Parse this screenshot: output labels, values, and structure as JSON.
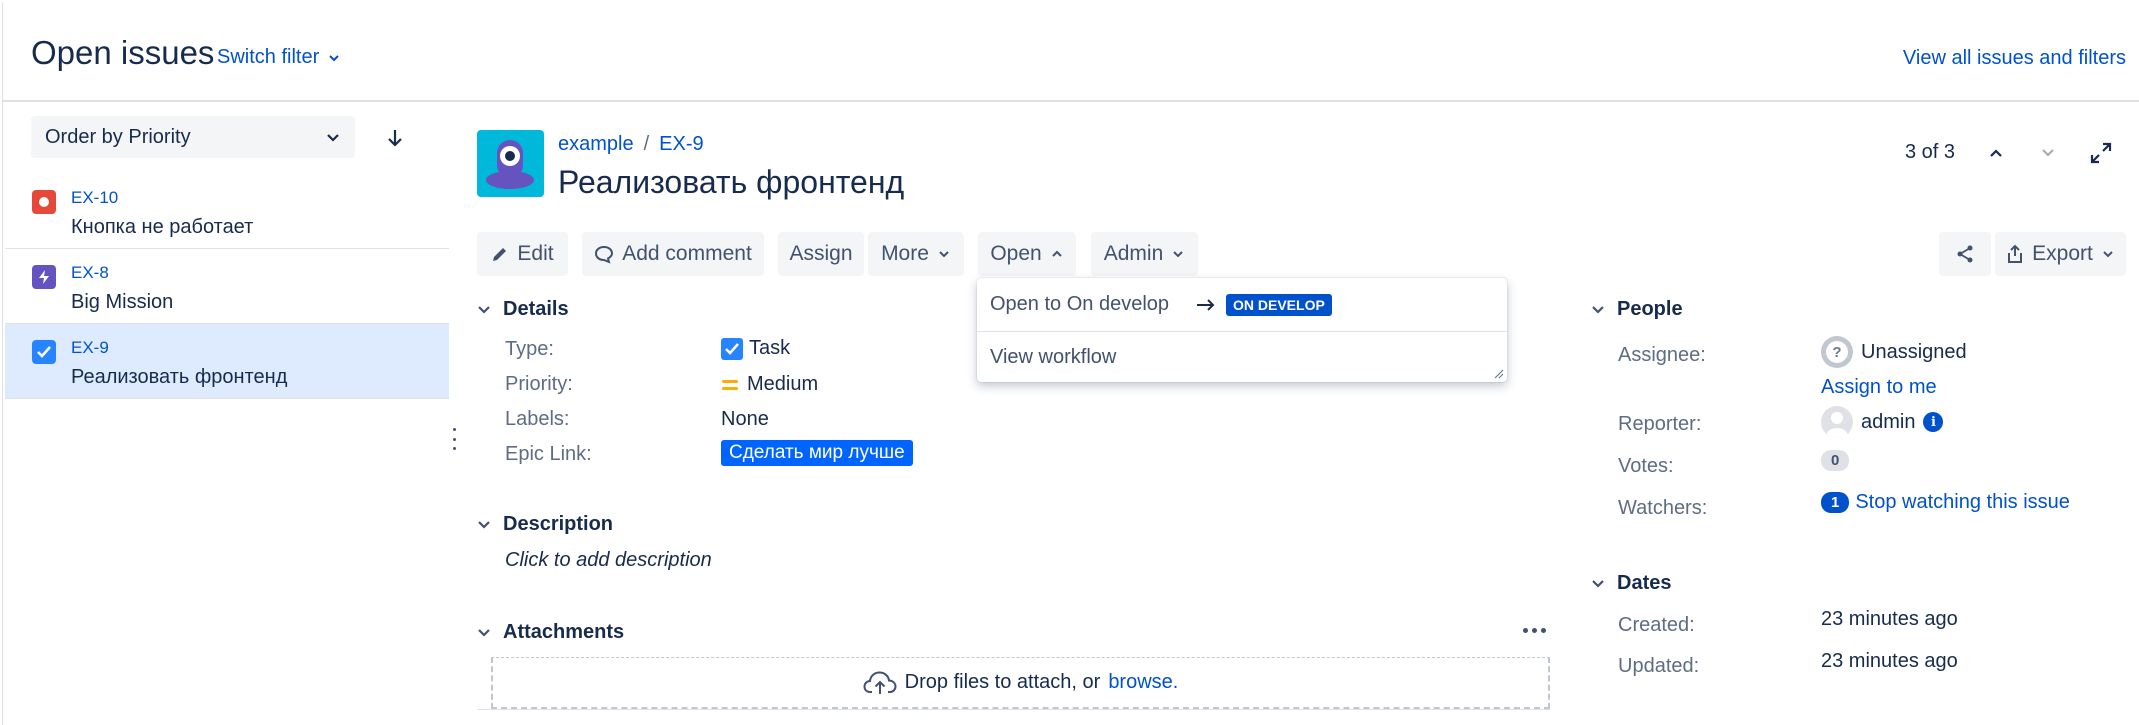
{
  "header": {
    "title": "Open issues",
    "switch_filter": "Switch filter",
    "view_all": "View all issues and filters"
  },
  "sidebar": {
    "order_label": "Order by Priority",
    "items": [
      {
        "key": "EX-10",
        "summary": "Кнопка не работает",
        "type": "bug",
        "color": "#e5493a"
      },
      {
        "key": "EX-8",
        "summary": "Big Mission",
        "type": "epic",
        "color": "#6554c0"
      },
      {
        "key": "EX-9",
        "summary": "Реализовать фронтенд",
        "type": "task",
        "color": "#2684ff"
      }
    ]
  },
  "issue": {
    "project": "example",
    "key": "EX-9",
    "summary": "Реализовать фронтенд",
    "pager": "3 of 3"
  },
  "toolbar": {
    "edit": "Edit",
    "add_comment": "Add comment",
    "assign": "Assign",
    "more": "More",
    "open": "Open",
    "admin": "Admin",
    "export": "Export"
  },
  "dropdown": {
    "transition": "Open to On develop",
    "status_lozenge": "ON DEVELOP",
    "view_workflow": "View workflow"
  },
  "details": {
    "heading": "Details",
    "type_label": "Type:",
    "type_value": "Task",
    "priority_label": "Priority:",
    "priority_value": "Medium",
    "labels_label": "Labels:",
    "labels_value": "None",
    "epic_label": "Epic Link:",
    "epic_value": "Сделать мир лучше"
  },
  "description": {
    "heading": "Description",
    "placeholder": "Click to add description"
  },
  "attachments": {
    "heading": "Attachments",
    "drop_text": "Drop files to attach, or",
    "browse": "browse."
  },
  "people": {
    "heading": "People",
    "assignee_label": "Assignee:",
    "assignee_value": "Unassigned",
    "assign_to_me": "Assign to me",
    "reporter_label": "Reporter:",
    "reporter_value": "admin",
    "votes_label": "Votes:",
    "votes_count": "0",
    "watchers_label": "Watchers:",
    "watchers_count": "1",
    "stop_watching": "Stop watching this issue"
  },
  "dates": {
    "heading": "Dates",
    "created_label": "Created:",
    "created_value": "23 minutes ago",
    "updated_label": "Updated:",
    "updated_value": "23 minutes ago"
  },
  "colors": {
    "link": "#0052cc",
    "selected_bg": "#deebff",
    "lozenge": "#0052cc",
    "priority_medium": "#ffab00",
    "epic": "#0065ff"
  }
}
